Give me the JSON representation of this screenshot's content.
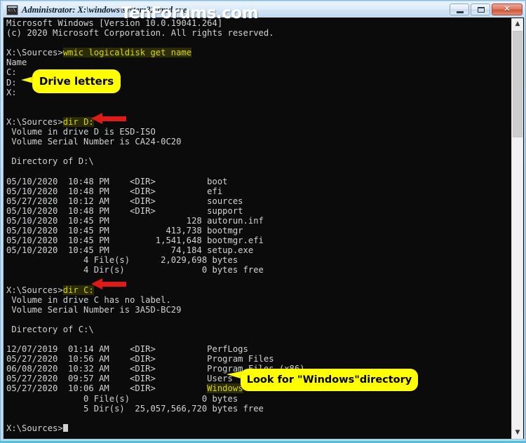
{
  "window": {
    "title": "Administrator: X:\\windows\\system32\\cmd.exe",
    "icon": "cmd-console-icon",
    "buttons": {
      "minimize": "–",
      "maximize": "□",
      "close": "✕"
    },
    "frame_color": "#c7dff3",
    "accent_bottom_color": "#4fc2d8"
  },
  "watermark": {
    "text": "TenForums.com"
  },
  "console": {
    "background_color": "#0b0b0b",
    "text_color": "#cfd3d6",
    "highlight_text_color": "#d9d700",
    "highlight_background_color": "#2c2c06",
    "lines": [
      {
        "text": "Microsoft Windows [Version 10.0.19041.264]"
      },
      {
        "text": "(c) 2020 Microsoft Corporation. All rights reserved."
      },
      {
        "text": ""
      },
      {
        "prompt": "X:\\Sources>",
        "command": "wmic logicaldisk get name"
      },
      {
        "text": "Name"
      },
      {
        "text": "C:"
      },
      {
        "text": "D:"
      },
      {
        "text": "X:"
      },
      {
        "text": ""
      },
      {
        "text": ""
      },
      {
        "prompt": "X:\\Sources>",
        "command": "dir D:"
      },
      {
        "text": " Volume in drive D is ESD-ISO"
      },
      {
        "text": " Volume Serial Number is CA24-0C20"
      },
      {
        "text": ""
      },
      {
        "text": " Directory of D:\\"
      },
      {
        "text": ""
      },
      {
        "text": "05/10/2020  10:48 PM    <DIR>          boot"
      },
      {
        "text": "05/10/2020  10:48 PM    <DIR>          efi"
      },
      {
        "text": "05/27/2020  10:12 AM    <DIR>          sources"
      },
      {
        "text": "05/10/2020  10:48 PM    <DIR>          support"
      },
      {
        "text": "05/10/2020  10:45 PM               128 autorun.inf"
      },
      {
        "text": "05/10/2020  10:45 PM           413,738 bootmgr"
      },
      {
        "text": "05/10/2020  10:45 PM         1,541,648 bootmgr.efi"
      },
      {
        "text": "05/10/2020  10:45 PM            74,184 setup.exe"
      },
      {
        "text": "               4 File(s)      2,029,698 bytes"
      },
      {
        "text": "               4 Dir(s)               0 bytes free"
      },
      {
        "text": ""
      },
      {
        "prompt": "X:\\Sources>",
        "command": "dir C:"
      },
      {
        "text": " Volume in drive C has no label."
      },
      {
        "text": " Volume Serial Number is 3A5D-BC29"
      },
      {
        "text": ""
      },
      {
        "text": " Directory of C:\\"
      },
      {
        "text": ""
      },
      {
        "text": "12/07/2019  01:14 AM    <DIR>          PerfLogs"
      },
      {
        "text": "05/27/2020  10:56 AM    <DIR>          Program Files"
      },
      {
        "text": "06/08/2020  10:32 AM    <DIR>          Program Files (x86)"
      },
      {
        "text": "05/27/2020  09:57 AM    <DIR>          Users"
      },
      {
        "text": "05/27/2020  10:06 AM    <DIR>          ",
        "highlight_tail": "Windows"
      },
      {
        "text": "               0 File(s)              0 bytes"
      },
      {
        "text": "               5 Dir(s)  25,057,566,720 bytes free"
      },
      {
        "text": ""
      },
      {
        "prompt": "X:\\Sources>",
        "command": "",
        "caret": true
      }
    ]
  },
  "scrollbar": {
    "up_arrow": "▲",
    "down_arrow": "▼"
  },
  "annotations": {
    "color": "#ffff00",
    "arrow_color": "#e01b17",
    "callouts": [
      {
        "id": "drive-letters",
        "text": "Drive letters"
      },
      {
        "id": "windows-dir",
        "text": "Look for \"Windows\"directory"
      }
    ],
    "arrows": [
      {
        "id": "arrow-dir-d",
        "points_to": "dir D:"
      },
      {
        "id": "arrow-dir-c",
        "points_to": "dir C:"
      }
    ]
  }
}
